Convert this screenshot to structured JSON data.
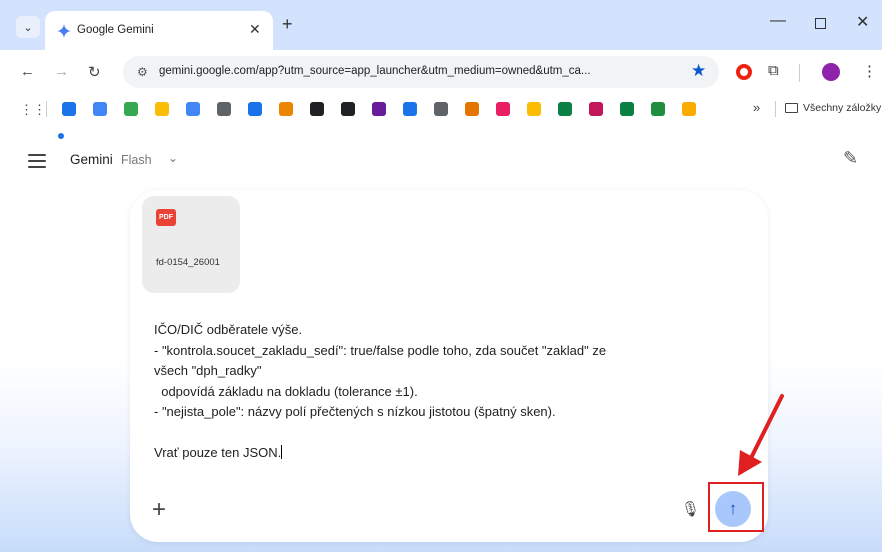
{
  "browser": {
    "tab_title": "Google Gemini",
    "url": "gemini.google.com/app?utm_source=app_launcher&utm_medium=owned&utm_ca...",
    "bookmarks_folder_label": "Všechny záložky",
    "bookmark_colors": [
      "#1a73e8",
      "#4285f4",
      "#34a853",
      "#fbbc04",
      "#4285f4",
      "#5f6368",
      "#1a73e8",
      "#ea8600",
      "#202124",
      "#202124",
      "#6a1b9a",
      "#1a73e8",
      "#5f6368",
      "#e37400",
      "#e91e63",
      "#fbbc04",
      "#0b8043",
      "#c2185b",
      "#0b8043",
      "#1e8e3e",
      "#f9ab00"
    ]
  },
  "gemini": {
    "title": "Gemini",
    "model": "Flash"
  },
  "attachment": {
    "badge": "PDF",
    "file_name": "fd-0154_26001"
  },
  "prompt_lines": [
    "IČO/DIČ odběratele výše.",
    "- \"kontrola.soucet_zakladu_sedí\": true/false podle toho, zda součet \"zaklad\" ze",
    "všech \"dph_radky\"",
    "  odpovídá základu na dokladu (tolerance ±1).",
    "- \"nejista_pole\": názvy polí přečtených s nízkou jistotou (špatný sken).",
    "",
    "Vrať pouze ten JSON."
  ],
  "annotation_color": "#e02020"
}
